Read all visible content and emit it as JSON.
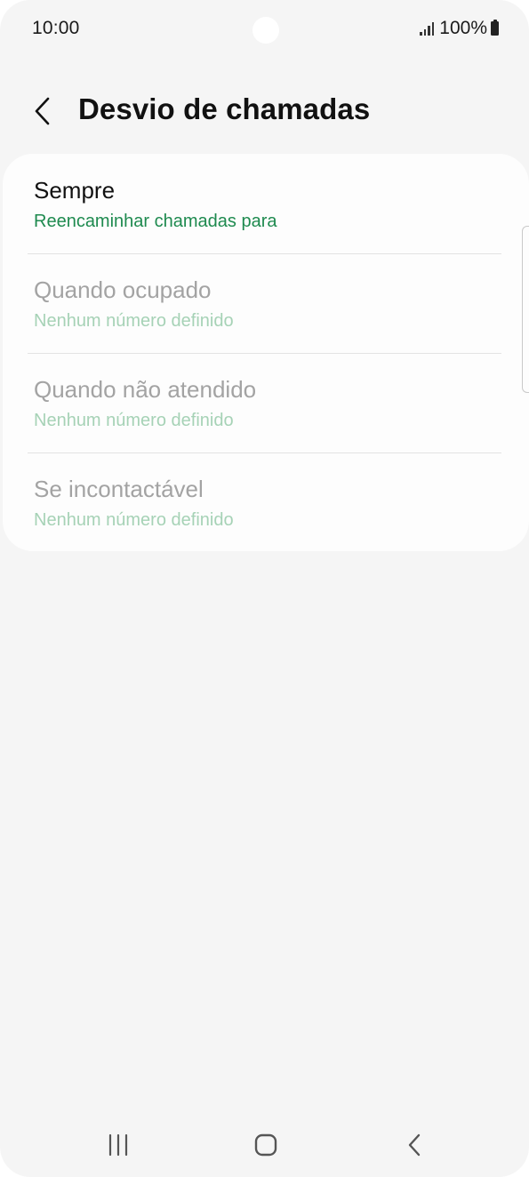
{
  "status_bar": {
    "time": "10:00",
    "battery": "100%",
    "signal_icon": "signal-bars-icon",
    "battery_icon": "battery-full-icon"
  },
  "header": {
    "title": "Desvio de chamadas",
    "back_icon": "chevron-left-icon"
  },
  "list": {
    "items": [
      {
        "title": "Sempre",
        "subtitle": "Reencaminhar chamadas para",
        "enabled": true
      },
      {
        "title": "Quando ocupado",
        "subtitle": "Nenhum número definido",
        "enabled": false
      },
      {
        "title": "Quando não atendido",
        "subtitle": "Nenhum número definido",
        "enabled": false
      },
      {
        "title": "Se incontactável",
        "subtitle": "Nenhum número definido",
        "enabled": false
      }
    ]
  },
  "nav_bar": {
    "recents_icon": "recents-icon",
    "home_icon": "home-icon",
    "back_icon": "back-chevron-icon"
  },
  "colors": {
    "background": "#f5f5f5",
    "card": "#fdfdfd",
    "accent_green": "#1e8a4f",
    "disabled_green": "#a6d2b6",
    "disabled_text": "#a3a3a3"
  }
}
